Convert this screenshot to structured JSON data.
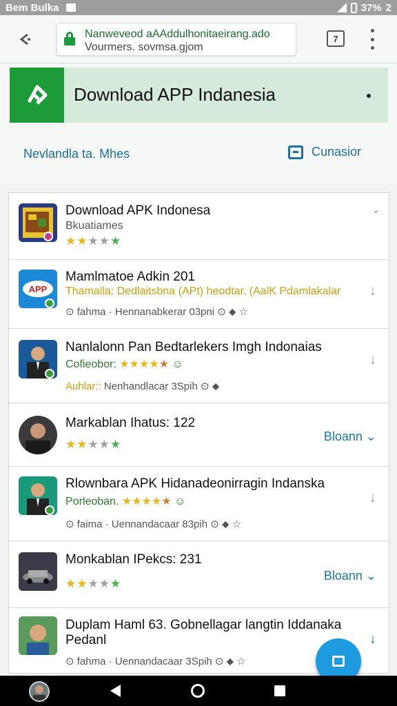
{
  "status_bar": {
    "carrier": "Bem Bulka",
    "battery": "37%",
    "sim_count": "2"
  },
  "browser": {
    "url_line1": "Nanweveod aAAddulhonitaeirang.ado",
    "url_line2": "Vourmers. sovmsa.gjom",
    "tab_count": "7"
  },
  "header": {
    "banner_title": "Download APP Indanesia",
    "nav_left": "Nevlandla ta. Mhes",
    "nav_right": "Cunasior"
  },
  "list": {
    "items": [
      {
        "title": "Download APK Indonesa",
        "subtitle": "Bkuatiames",
        "stars_filled": 2,
        "stars_total": 5
      },
      {
        "title": "Mamlmatoe Adkin 201",
        "subtitle": "Thamalla: Dedlaitsbna (APt) heodtar. (AalK Pdamlakalar",
        "meta1": "fahma",
        "meta2": "Hennanabkerar",
        "meta3": "03pni"
      },
      {
        "title": "Nanlalonn Pan Bedtarlekers Imgh Indonaias",
        "subtitle": "Cofieobor:",
        "extra": "Auhlar::",
        "meta2": "Nenhandlacar",
        "meta3": "3Spih"
      },
      {
        "title": "Markablan Ihatus: 122",
        "stars_filled": 2,
        "link": "Bloann"
      },
      {
        "title": "Rlownbara APK Hidanadeonirragin Indanska",
        "subtitle": "Porleoban.",
        "meta1": "faima",
        "meta2": "Uennandacaar",
        "meta3": "83pih"
      },
      {
        "title": "Monkablan IPekcs: 231",
        "stars_filled": 2,
        "link": "Bloann"
      },
      {
        "title": "Duplam Haml 63. Gobnellagar langtin Iddanaka",
        "title2": "Pedanl",
        "meta1": "fahma",
        "meta2": "Uennandacaar",
        "meta3": "3Spih"
      }
    ]
  },
  "colors": {
    "brand_green": "#1e9b39",
    "link_blue": "#1a78a8",
    "fab_blue": "#1e9ae0"
  }
}
